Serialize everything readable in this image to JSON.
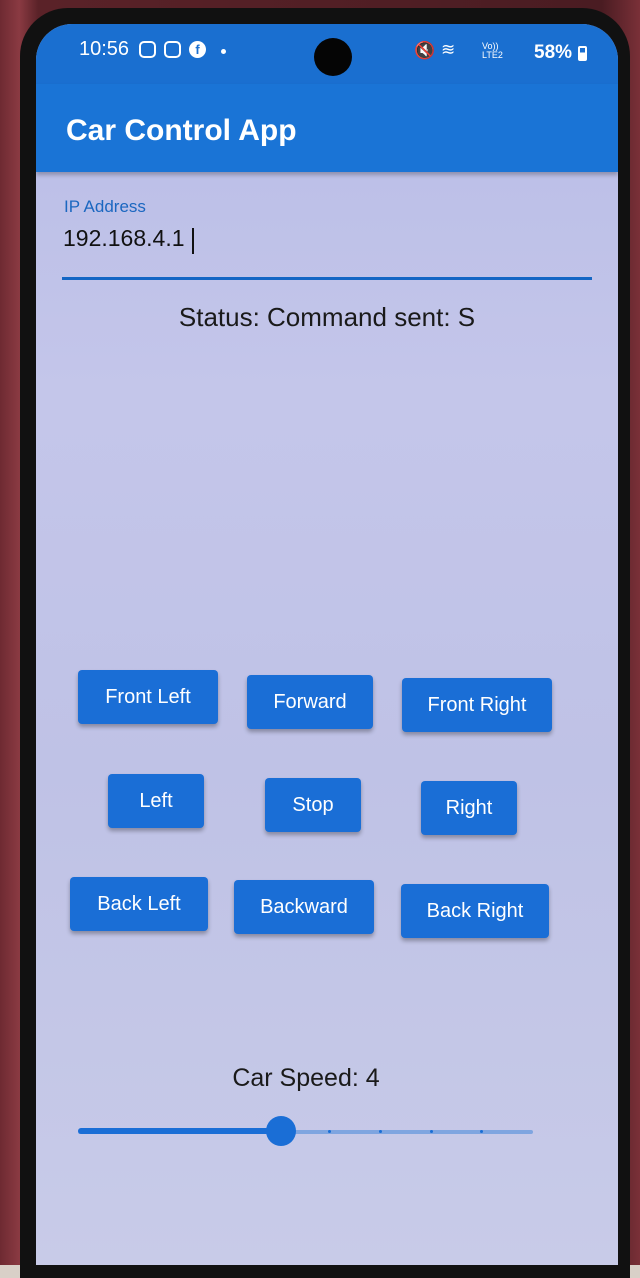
{
  "status_bar": {
    "time": "10:56",
    "carrier": "Vo))\nLTE2",
    "battery": "58%",
    "mute_glyph": "🔇",
    "wifi_glyph": "≋"
  },
  "app_bar": {
    "title": "Car Control App"
  },
  "ip_field": {
    "label": "IP Address",
    "value": "192.168.4.1"
  },
  "status": {
    "text": "Status: Command sent: S"
  },
  "controls": {
    "front_left": "Front Left",
    "forward": "Forward",
    "front_right": "Front Right",
    "left": "Left",
    "stop": "Stop",
    "right": "Right",
    "back_left": "Back Left",
    "backward": "Backward",
    "back_right": "Back Right"
  },
  "speed": {
    "label": "Car Speed: 4",
    "value": 4,
    "min": 0,
    "max": 10
  },
  "colors": {
    "primary": "#1a6ed6",
    "app_bar": "#1a74d6",
    "background": "#c4c6ea"
  }
}
